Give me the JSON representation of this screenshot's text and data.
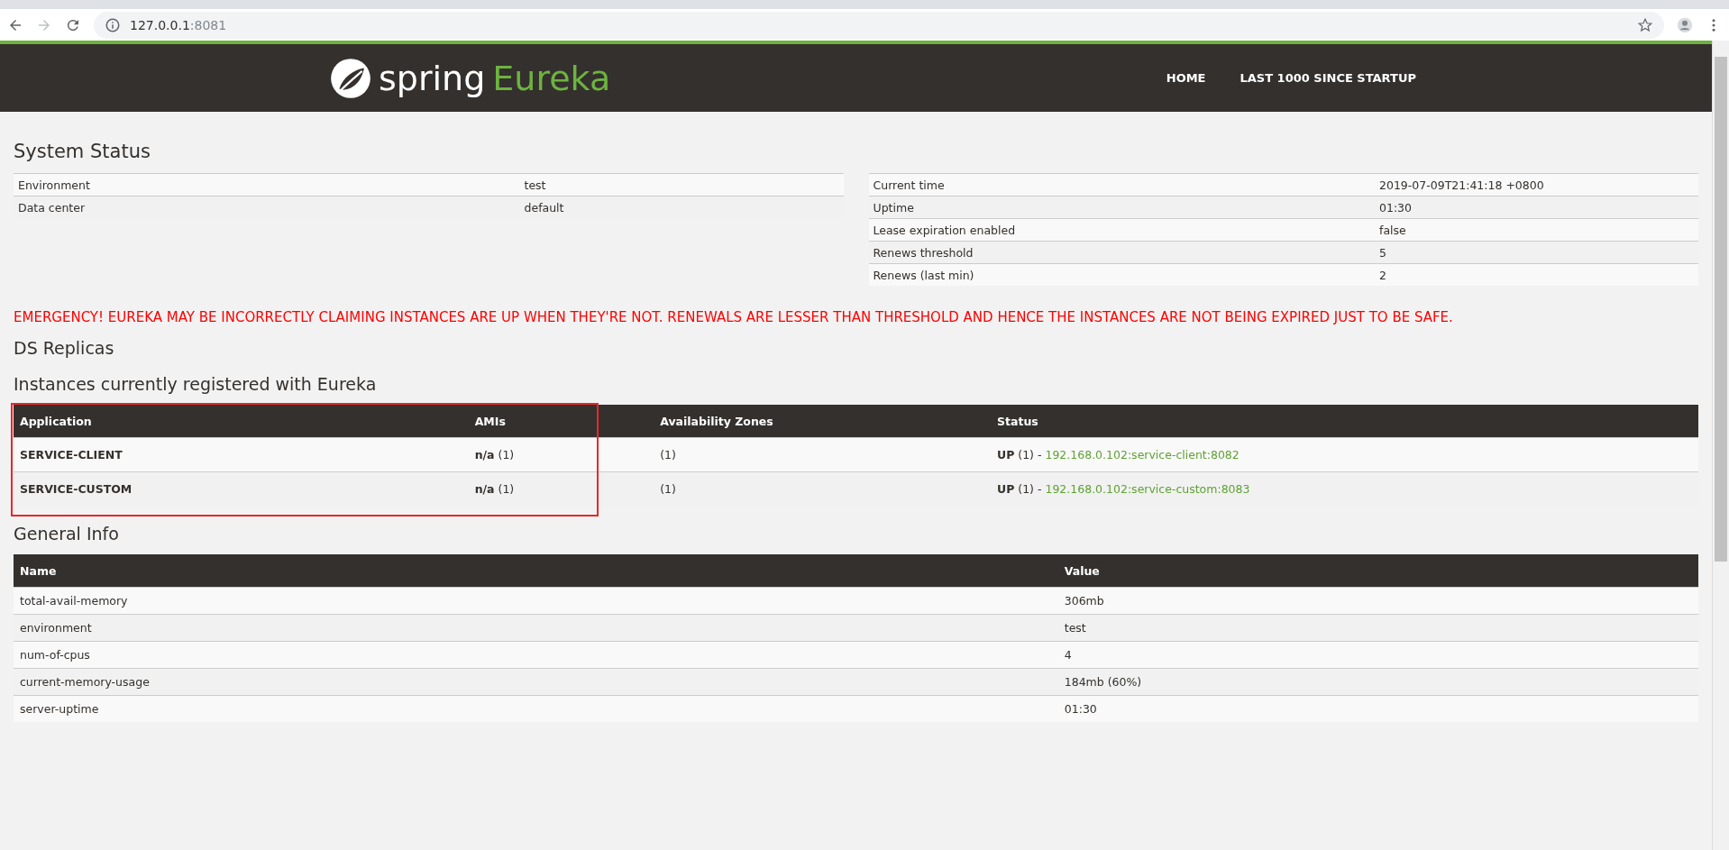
{
  "browser": {
    "url_host": "127.0.0.1",
    "url_port": ":8081"
  },
  "header": {
    "logo_word": "spring",
    "logo_product": "Eureka",
    "nav": [
      {
        "label": "HOME"
      },
      {
        "label": "LAST 1000 SINCE STARTUP"
      }
    ]
  },
  "system_status": {
    "title": "System Status",
    "left": [
      {
        "name": "Environment",
        "value": "test"
      },
      {
        "name": "Data center",
        "value": "default"
      }
    ],
    "right": [
      {
        "name": "Current time",
        "value": "2019-07-09T21:41:18 +0800"
      },
      {
        "name": "Uptime",
        "value": "01:30"
      },
      {
        "name": "Lease expiration enabled",
        "value": "false"
      },
      {
        "name": "Renews threshold",
        "value": "5"
      },
      {
        "name": "Renews (last min)",
        "value": "2"
      }
    ]
  },
  "warning": "EMERGENCY! EUREKA MAY BE INCORRECTLY CLAIMING INSTANCES ARE UP WHEN THEY'RE NOT. RENEWALS ARE LESSER THAN THRESHOLD AND HENCE THE INSTANCES ARE NOT BEING EXPIRED JUST TO BE SAFE.",
  "ds_replicas": {
    "title": "DS Replicas"
  },
  "instances": {
    "title": "Instances currently registered with Eureka",
    "highlighted": true,
    "columns": [
      "Application",
      "AMIs",
      "Availability Zones",
      "Status"
    ],
    "rows": [
      {
        "application": "SERVICE-CLIENT",
        "amis": "**n/a** (1)",
        "zones": "(1)",
        "status": "**UP** (1) - ",
        "link": "192.168.0.102:service-client:8082"
      },
      {
        "application": "SERVICE-CUSTOM",
        "amis": "**n/a** (1)",
        "zones": "(1)",
        "status": "**UP** (1) - ",
        "link": "192.168.0.102:service-custom:8083"
      }
    ]
  },
  "general_info": {
    "title": "General Info",
    "columns": [
      "Name",
      "Value"
    ],
    "rows": [
      {
        "name": "total-avail-memory",
        "value": "306mb"
      },
      {
        "name": "environment",
        "value": "test"
      },
      {
        "name": "num-of-cpus",
        "value": "4"
      },
      {
        "name": "current-memory-usage",
        "value": "184mb (60%)"
      },
      {
        "name": "server-uptime",
        "value": "01:30"
      }
    ]
  }
}
